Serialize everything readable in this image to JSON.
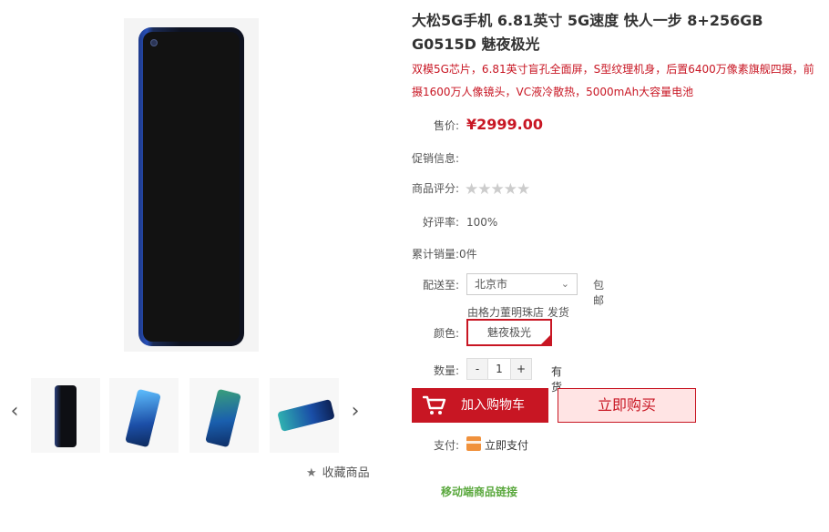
{
  "product": {
    "title": "大松5G手机 6.81英寸 5G速度 快人一步 8+256GB G0515D 魅夜极光",
    "subtitle": "双模5G芯片，6.81英寸盲孔全面屏，S型纹理机身，后置6400万像素旗舰四摄，前摄1600万人像镜头，VC液冷散热，5000mAh大容量电池"
  },
  "price": {
    "label": "售价:",
    "value": "¥2999.00"
  },
  "promo": {
    "label": "促销信息:"
  },
  "rating": {
    "label": "商品评分:",
    "stars": "★★★★★",
    "score": 0
  },
  "good_rate": {
    "label": "好评率:",
    "value": "100%"
  },
  "sales": {
    "label": "累计销量:",
    "value": "0件"
  },
  "shipping": {
    "label": "配送至:",
    "city": "北京市",
    "note": "包邮",
    "shop": "由格力董明珠店 发货"
  },
  "color": {
    "label": "颜色:",
    "selected": "魅夜极光"
  },
  "quantity": {
    "label": "数量:",
    "minus": "-",
    "value": "1",
    "plus": "+",
    "stock": "有货"
  },
  "buttons": {
    "cart": "加入购物车",
    "buy": "立即购买"
  },
  "payment": {
    "label": "支付:",
    "method": "立即支付"
  },
  "gallery": {
    "prev": "‹",
    "next": "›",
    "favorite_icon": "★",
    "favorite": "收藏商品"
  },
  "mobile_link": "移动端商品链接",
  "colors": {
    "accent": "#c81623",
    "link_green": "#5aa83d"
  }
}
